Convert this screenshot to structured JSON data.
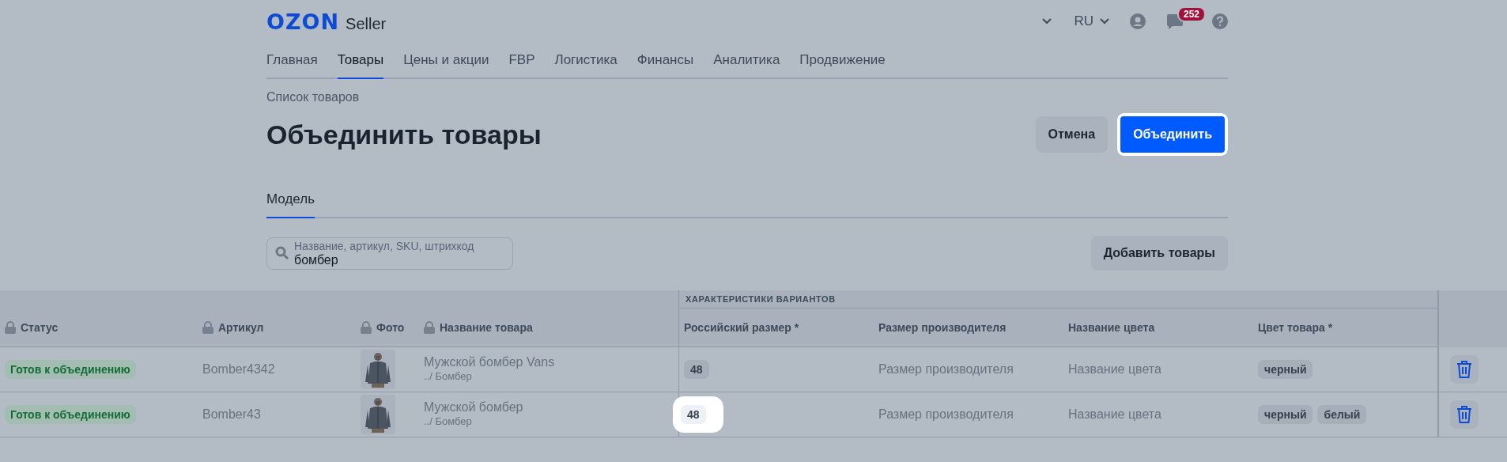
{
  "header": {
    "logo": {
      "brand": "OZON",
      "product": "Seller"
    },
    "language": "RU",
    "messages_badge": "252"
  },
  "nav": [
    {
      "label": "Главная",
      "selected": false
    },
    {
      "label": "Товары",
      "selected": true
    },
    {
      "label": "Цены и акции",
      "selected": false
    },
    {
      "label": "FBP",
      "selected": false
    },
    {
      "label": "Логистика",
      "selected": false
    },
    {
      "label": "Финансы",
      "selected": false
    },
    {
      "label": "Аналитика",
      "selected": false
    },
    {
      "label": "Продвижение",
      "selected": false
    }
  ],
  "breadcrumb": "Список товаров",
  "title": "Объединить товары",
  "actions": [
    {
      "label": "Отмена",
      "kind": "secondary",
      "highlighted": false
    },
    {
      "label": "Объединить",
      "kind": "primary",
      "highlighted": true
    }
  ],
  "tabs": [
    {
      "label": "Модель",
      "selected": true
    }
  ],
  "search": {
    "placeholder": "Название, артикул, SKU, штрихкод",
    "value": "бомбер"
  },
  "add_button": "Добавить товары",
  "table": {
    "group_header": "ХАРАКТЕРИСТИКИ ВАРИАНТОВ",
    "columns": [
      {
        "label": "Статус",
        "locked": true
      },
      {
        "label": "Артикул",
        "locked": true
      },
      {
        "label": "Фото",
        "locked": true
      },
      {
        "label": "Название товара",
        "locked": true
      },
      {
        "label": "Российский размер *",
        "locked": false
      },
      {
        "label": "Размер производителя",
        "locked": false
      },
      {
        "label": "Название цвета",
        "locked": false
      },
      {
        "label": "Цвет товара *",
        "locked": false
      }
    ],
    "rows": [
      {
        "status": "Готов к объединению",
        "article": "Bomber4342",
        "photo": {
          "kind": "picture"
        },
        "name": "Мужской бомбер Vans",
        "path": "../ Бомбер",
        "size": {
          "value": "48",
          "highlighted": false
        },
        "manufacturer_size": "Размер производителя",
        "color_name": "Название цвета",
        "colors": [
          "черный"
        ]
      },
      {
        "status": "Готов к объединению",
        "article": "Bomber43",
        "photo": {
          "kind": "picture"
        },
        "name": "Мужской бомбер",
        "path": "../ Бомбер",
        "size": {
          "value": "48",
          "highlighted": true
        },
        "manufacturer_size": "Размер производителя",
        "color_name": "Название цвета",
        "colors": [
          "черный",
          "белый"
        ]
      }
    ]
  }
}
